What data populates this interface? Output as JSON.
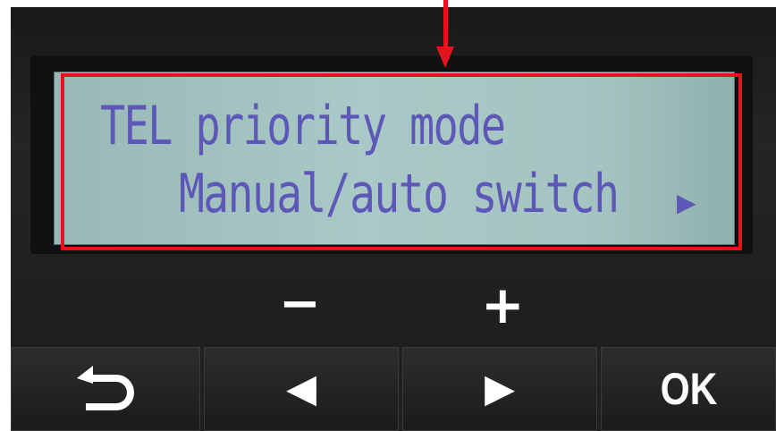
{
  "display": {
    "line1": "TEL priority mode",
    "line2": "Manual/auto switch",
    "next_indicator": "▶"
  },
  "labels": {
    "minus": "−",
    "plus": "+"
  },
  "buttons": {
    "left_arrow": "◀",
    "right_arrow": "▶",
    "ok": "OK"
  },
  "colors": {
    "lcd_text": "#5d57b8",
    "highlight": "#e4141d"
  }
}
